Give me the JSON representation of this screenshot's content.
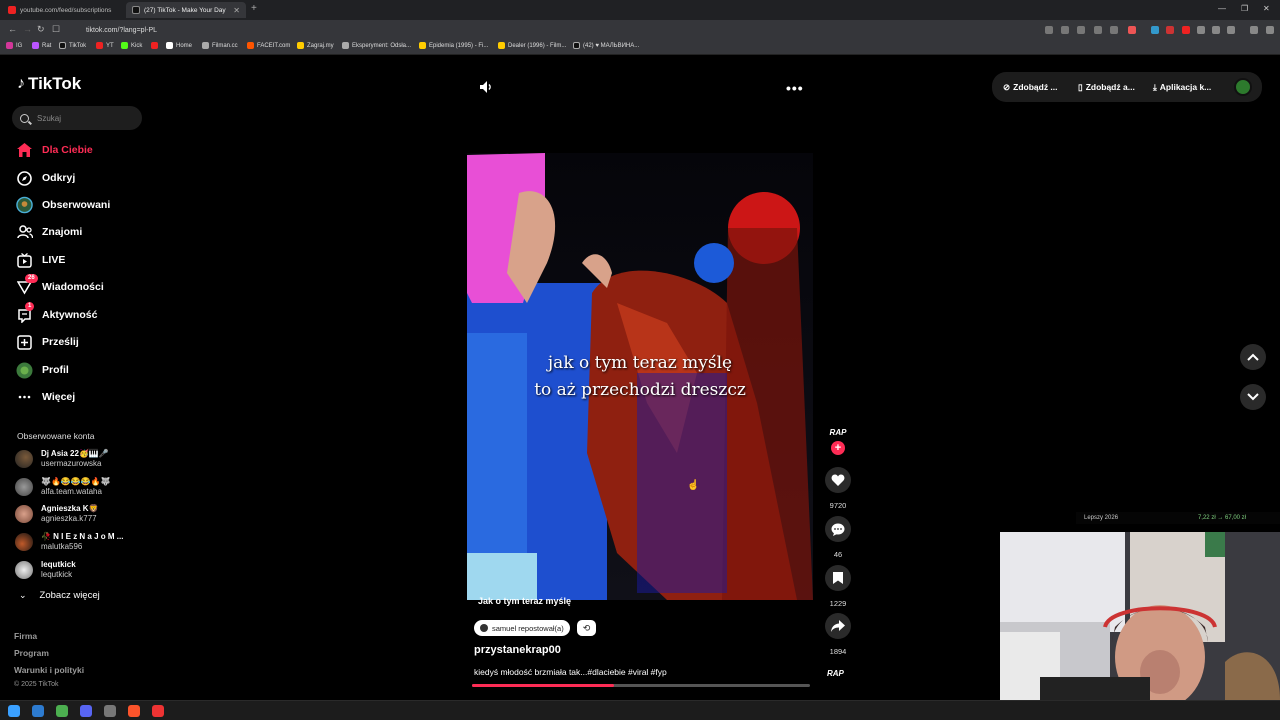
{
  "browser": {
    "tabs": [
      {
        "title": "youtube.com/feed/subscriptions",
        "active": false
      },
      {
        "title": "(27) TikTok - Make Your Day",
        "active": true
      }
    ],
    "url": "tiktok.com/?lang=pl-PL",
    "bookmarks": [
      "IG",
      "Rat",
      "TikTok",
      "YT",
      "Kick",
      "Home",
      "Home",
      "Filman.cc",
      "FACEIT.com",
      "Zagraj.my",
      "Eksperyment: Odsła...",
      "Epidemia (1995) - Fi...",
      "Dealer (1996) - Film...",
      "(42) ♥ МАЛЬВИНА..."
    ]
  },
  "sidebar": {
    "logo": "TikTok",
    "search_placeholder": "Szukaj",
    "nav": [
      {
        "label": "Dla Ciebie",
        "icon": "home-icon",
        "active": true
      },
      {
        "label": "Odkryj",
        "icon": "compass-icon"
      },
      {
        "label": "Obserwowani",
        "icon": "following-avatar-icon"
      },
      {
        "label": "Znajomi",
        "icon": "friends-icon"
      },
      {
        "label": "LIVE",
        "icon": "live-icon"
      },
      {
        "label": "Wiadomości",
        "icon": "messages-icon",
        "badge": "26"
      },
      {
        "label": "Aktywność",
        "icon": "activity-icon",
        "badge": "1"
      },
      {
        "label": "Prześlij",
        "icon": "upload-icon"
      },
      {
        "label": "Profil",
        "icon": "profile-avatar-icon"
      },
      {
        "label": "Więcej",
        "icon": "more-icon"
      }
    ],
    "following_title": "Obserwowane konta",
    "accounts": [
      {
        "name": "Dj Asia 22🥳🎹🎤",
        "handle": "usermazurowska"
      },
      {
        "name": "🐺🔥😂😂😂🔥🐺",
        "handle": "alfa.team.wataha"
      },
      {
        "name": "Agnieszka K🦁",
        "handle": "agnieszka.k777"
      },
      {
        "name": "🥀 N I E z N a J o M ...",
        "handle": "malutka596"
      },
      {
        "name": "lequtkick",
        "handle": "lequtkick"
      }
    ],
    "see_more": "Zobacz więcej",
    "footer": [
      "Firma",
      "Program",
      "Warunki i polityki"
    ],
    "copyright": "© 2025 TikTok"
  },
  "video": {
    "overlay_text_line1": "jak o tym teraz myślę",
    "overlay_text_line2": "to aż przechodzi dreszcz",
    "bottom_text": "Jak o tym teraz myślę",
    "repost_label": "samuel repostował(a)",
    "author": "przystanekrap00",
    "description": "kiedyś młodość brzmiała tak...#dlaciebie #viral #fyp",
    "progress": 0.42
  },
  "actions": {
    "avatar_text": "RAP",
    "likes": "9720",
    "comments": "46",
    "saves": "1229",
    "shares": "1894",
    "music_text": "RAP"
  },
  "top_right": {
    "btn1": "Zdobądź ...",
    "btn2": "Zdobądź a...",
    "btn3": "Aplikacja k..."
  },
  "stream_overlay": {
    "left": "Lepszy 2026",
    "right": "7,22 zł → 67,00 zł"
  }
}
